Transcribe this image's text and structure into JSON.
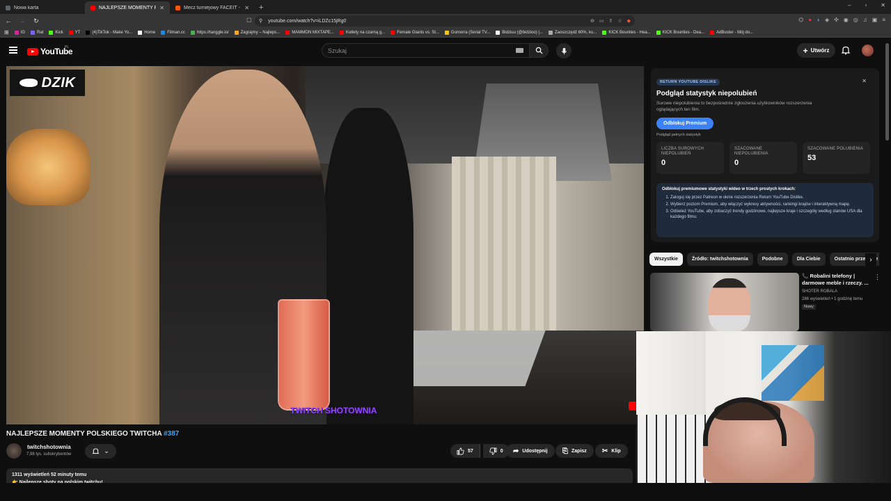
{
  "browser": {
    "tabs": [
      {
        "label": "Nowa karta",
        "color": "#5f6368",
        "active": false
      },
      {
        "label": "NAJLEPSZE MOMENTY POLSK",
        "color": "#ff0000",
        "active": true
      },
      {
        "label": "Mecz turniejowy FACEIT - FACEIT.com",
        "color": "#ff5500",
        "active": false
      }
    ],
    "new_tab": "+",
    "url": "youtube.com/watch?v=iLDZc15jRg0",
    "bookmarks": [
      {
        "label": "IG",
        "color": "#d6249f"
      },
      {
        "label": "Rat",
        "color": "#7b61ff"
      },
      {
        "label": "Kick",
        "color": "#53fc18"
      },
      {
        "label": "YT",
        "color": "#ff0000"
      },
      {
        "label": "(4)TikTok - Make Yo...",
        "color": "#000000"
      },
      {
        "label": "Home",
        "color": "#ffffff"
      },
      {
        "label": "Filman.cc",
        "color": "#1e88e5"
      },
      {
        "label": "https://tanggle.io/",
        "color": "#4caf50"
      },
      {
        "label": "Zagrajmy – Najleps...",
        "color": "#f5a623"
      },
      {
        "label": "MAMMON MIXTAPE...",
        "color": "#ff0000"
      },
      {
        "label": "Kotlety na czarną g...",
        "color": "#ff0000"
      },
      {
        "label": "Female Giants vs. St...",
        "color": "#ff0000"
      },
      {
        "label": "Gomorra (Serial TV...",
        "color": "#f5c518"
      },
      {
        "label": "Bidziuu (@bidzioo) |...",
        "color": "#ffffff"
      },
      {
        "label": "Zaoszczędź 60%, ku...",
        "color": "#aaaaaa"
      },
      {
        "label": "KICK Bounties - Hea...",
        "color": "#53fc18"
      },
      {
        "label": "KICK Bounties - Dea...",
        "color": "#53fc18"
      },
      {
        "label": "AdBuster - Mój do...",
        "color": "#ff0000"
      }
    ]
  },
  "yt_header": {
    "logo_text": "YouTube",
    "region": "PL",
    "search_placeholder": "Szukaj",
    "create_label": "Utwórz"
  },
  "video": {
    "channel_badge": "DZIK",
    "watermark": "TWITCH SHOTOWNIA",
    "title_main": "NAJLEPSZE MOMENTY POLSKIEGO TWITCHA ",
    "title_tag": "#387",
    "channel_name": "twitchshotownia",
    "subscribers": "7,98 tys. subskrybentów",
    "likes": "57",
    "dislikes": "0",
    "share_label": "Udostępnij",
    "save_label": "Zapisz",
    "clip_label": "Klip",
    "views": "1311 wyświetleń  52 minuty temu",
    "desc_line": "👉 Najlepsze shoty na polskim twitchu!"
  },
  "dislike_panel": {
    "badge": "RETURN YOUTUBE DISLIKE",
    "title": "Podgląd statystyk niepolubień",
    "subtitle": "Surowe niepolubienia to bezpośrednie zgłoszenia użytkowników rozszerzenia oglądających ten film.",
    "unlock_button": "Odblokuj Premium",
    "note": "Podgląd pełnych statystyk",
    "stats": [
      {
        "label": "LICZBA SUROWYCH NIEPOLUBIEŃ",
        "value": "0"
      },
      {
        "label": "SZACOWANE NIEPOLUBIENIA",
        "value": "0"
      },
      {
        "label": "SZACOWANE POLUBIENIA",
        "value": "53"
      }
    ],
    "steps_header": "Odblokuj premiumowe statystyki wideo w trzech prostych krokach:",
    "steps": [
      "Zaloguj się przez Patreon w oknie rozszerzenia Return YouTube Dislike.",
      "Wybierz poziom Premium, aby włączyć wykresy aktywności, rankingi krajów i interaktywną mapę.",
      "Odśwież YouTube, aby zobaczyć trendy godzinowe, najlepsze kraje i szczegóły według stanów USA dla każdego filmu."
    ]
  },
  "chips": [
    "Wszystkie",
    "Źródło: twitchshotownia",
    "Podobne",
    "Dla Ciebie",
    "Ostatnio przesłane"
  ],
  "recommended": {
    "title": "Robalini telefony | darmowe meble i rzeczy. ...",
    "channel": "SHOTER ROBALA",
    "meta": "286 wyświetleń • 1 godzinę temu",
    "badge": "Nowy"
  }
}
